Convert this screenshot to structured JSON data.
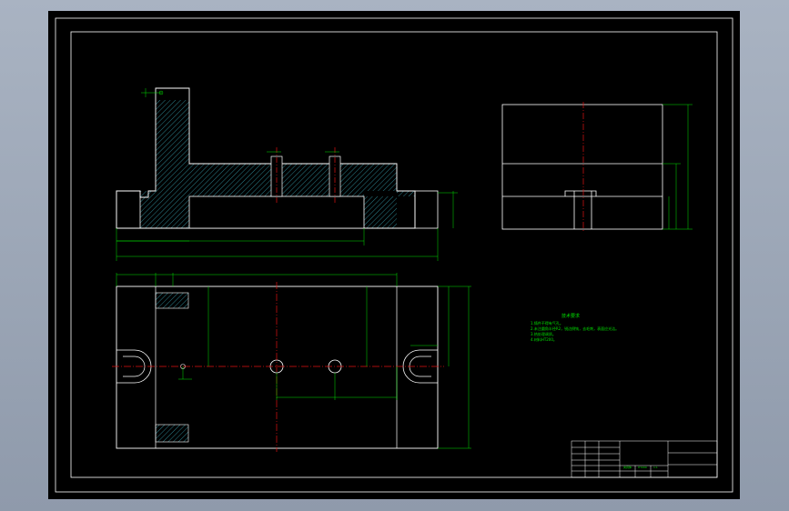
{
  "drawing": {
    "technical_requirements": {
      "title": "技术要求",
      "items": [
        "1.铸件不得有气孔。",
        "2.未注圆角半径R2，锐边倒钝，去毛刺，表面应光洁。",
        "3.热处理调质。",
        "4.材料HT200。"
      ]
    },
    "title_block": {
      "cells": [
        "夹具体",
        "HT200",
        "1:1"
      ]
    },
    "colors": {
      "outline": "#ffffff",
      "dimension": "#00e000",
      "centerline": "#e01010",
      "background": "#000000"
    }
  }
}
